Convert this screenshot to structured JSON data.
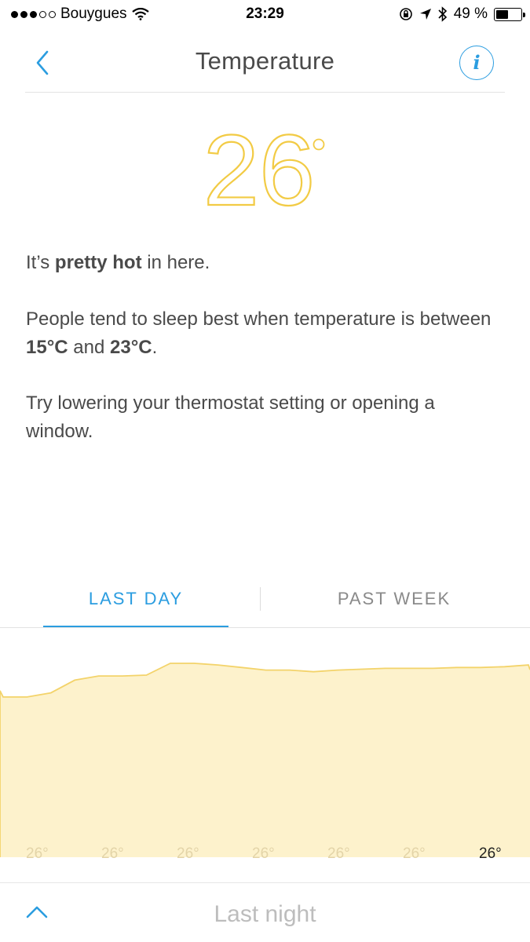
{
  "status_bar": {
    "carrier": "Bouygues",
    "time": "23:29",
    "battery": "49 %",
    "battery_level": 0.49
  },
  "nav": {
    "title": "Temperature",
    "back_icon": "chevron-left-icon",
    "info_icon": "info-icon",
    "info_glyph": "i"
  },
  "reading": {
    "value": "26",
    "unit": "°",
    "color": "#f2cb45"
  },
  "message": {
    "line1_pre": "It’s ",
    "line1_bold": "pretty hot",
    "line1_post": " in here.",
    "line2_pre": "People tend to sleep best when temperature is between ",
    "line2_bold_low": "15°C",
    "line2_mid": " and ",
    "line2_bold_high": "23°C",
    "line2_post": ".",
    "line3": "Try lowering your thermostat setting or opening a window."
  },
  "tabs": [
    {
      "label": "LAST DAY",
      "active": true
    },
    {
      "label": "PAST WEEK",
      "active": false
    }
  ],
  "accent_color": "#2b9de0",
  "chart_data": {
    "type": "area",
    "tick_labels": [
      "26°",
      "26°",
      "26°",
      "26°",
      "26°",
      "26°",
      "26°"
    ],
    "current_label": "26°",
    "series": [
      {
        "values": [
          25.8,
          25.8,
          25.85,
          26.0,
          26.05,
          26.05,
          26.06,
          26.2,
          26.2,
          26.18,
          26.15,
          26.12,
          26.12,
          26.1,
          26.12,
          26.13,
          26.14,
          26.14,
          26.14,
          26.15,
          26.15,
          26.16,
          26.18
        ]
      }
    ],
    "fill_color": "#fdf2cc",
    "line_color": "#f3d36a"
  },
  "bottom": {
    "label": "Last night",
    "chevron_icon": "chevron-up-icon"
  }
}
